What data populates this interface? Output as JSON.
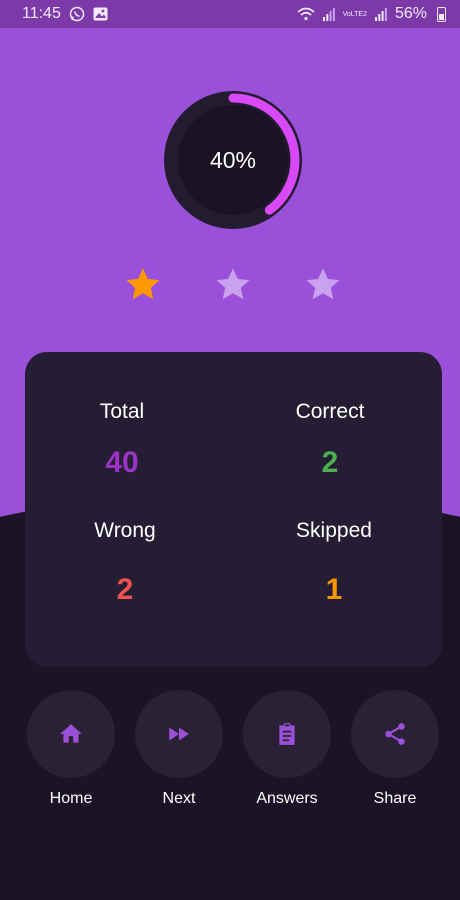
{
  "status_bar": {
    "time": "11:45",
    "battery": "56%",
    "network": "VoLTE2"
  },
  "result": {
    "percent_label": "40%",
    "progress_fraction": 0.4,
    "stars_earned": 1,
    "stars_total": 3
  },
  "stats": {
    "total_label": "Total",
    "total_value": "40",
    "correct_label": "Correct",
    "correct_value": "2",
    "wrong_label": "Wrong",
    "wrong_value": "2",
    "skipped_label": "Skipped",
    "skipped_value": "1"
  },
  "actions": {
    "home_label": "Home",
    "next_label": "Next",
    "answers_label": "Answers",
    "share_label": "Share"
  },
  "colors": {
    "background_top": "#9a50d8",
    "background_bottom": "#1b1426",
    "card": "#251d33",
    "ring_progress": "#d84af8",
    "total_value": "#9b34c4",
    "correct_value": "#4caf50",
    "wrong_value": "#ef5350",
    "skipped_value": "#ff9800",
    "star_active": "#ff9800",
    "star_inactive": "#c9a1ee",
    "icon": "#9b50d8"
  },
  "icons": {
    "home": "home-icon",
    "next": "fast-forward-icon",
    "answers": "clipboard-icon",
    "share": "share-icon"
  }
}
